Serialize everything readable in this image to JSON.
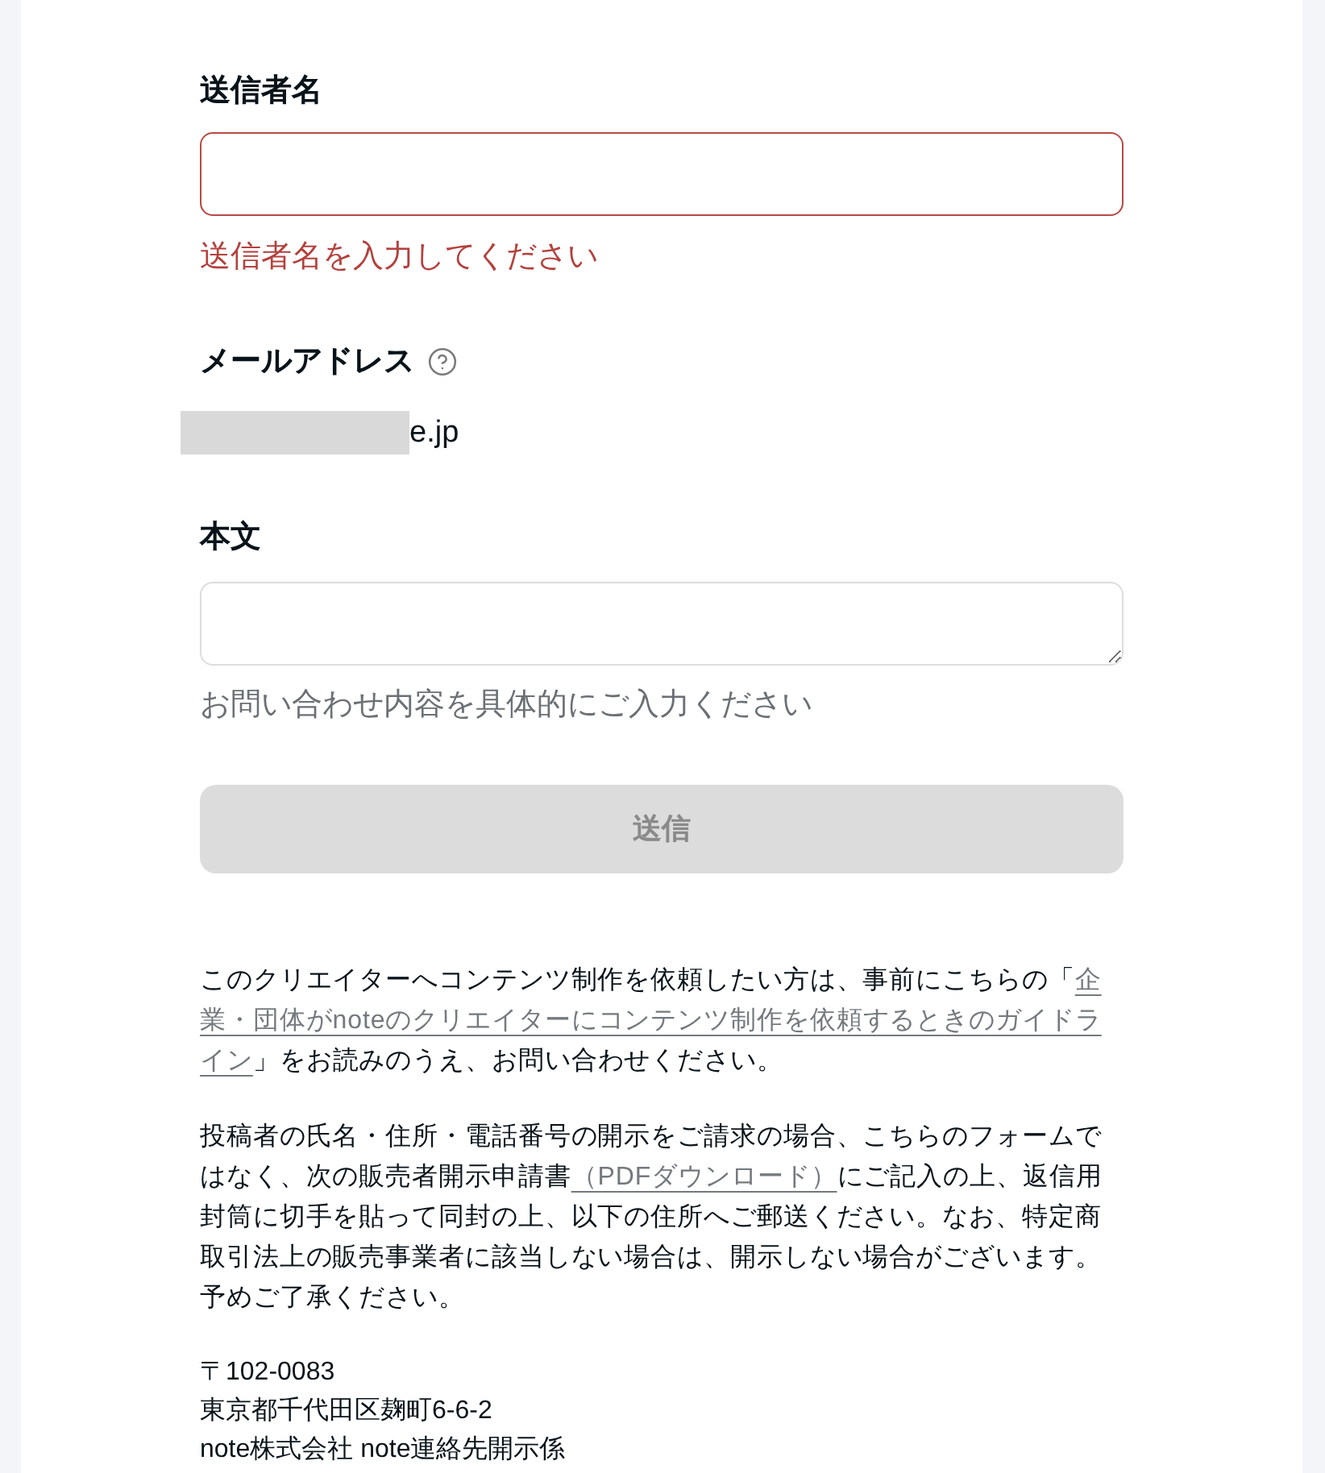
{
  "form": {
    "fields": [
      {
        "kind": "input",
        "label": "送信者名",
        "invalid": true,
        "error": "送信者名を入力してください"
      },
      {
        "kind": "static",
        "label": "メールアドレス",
        "help_icon": true,
        "redacted": true,
        "value": "e.jp"
      },
      {
        "kind": "textarea",
        "label": "本文",
        "invalid": false,
        "hint": "お問い合わせ内容を具体的にご入力ください"
      }
    ],
    "submit": {
      "label": "送信",
      "disabled": true
    }
  },
  "notes": [
    {
      "segments": [
        {
          "kind": "text",
          "text": "このクリエイターへコンテンツ制作を依頼したい方は、事前にこちらの「"
        },
        {
          "kind": "link",
          "text": "企"
        },
        {
          "kind": "link",
          "text": "業・団体がnoteのクリエイターにコンテンツ制作を依頼するときのガイドラ"
        },
        {
          "kind": "link",
          "text": "イン"
        },
        {
          "kind": "text",
          "text": "」をお読みのうえ、お問い合わせください。"
        }
      ]
    },
    {
      "segments": [
        {
          "kind": "text",
          "text": "投稿者の氏名・住所・電話番号の開示をご請求の場合、こちらのフォームではなく、次の販売者開示申請書"
        },
        {
          "kind": "link",
          "text": "（PDFダウンロード）"
        },
        {
          "kind": "text",
          "text": "にご記入の上、返信用封筒に切手を貼って同封の上、以下の住所へご郵送ください。なお、特定商取引法上の販売事業者に該当しない場合は、開示しない場合がございます。予めご了承ください。"
        }
      ]
    }
  ],
  "address": [
    "〒102-0083",
    "東京都千代田区麹町6-6-2",
    "note株式会社 note連絡先開示係"
  ]
}
